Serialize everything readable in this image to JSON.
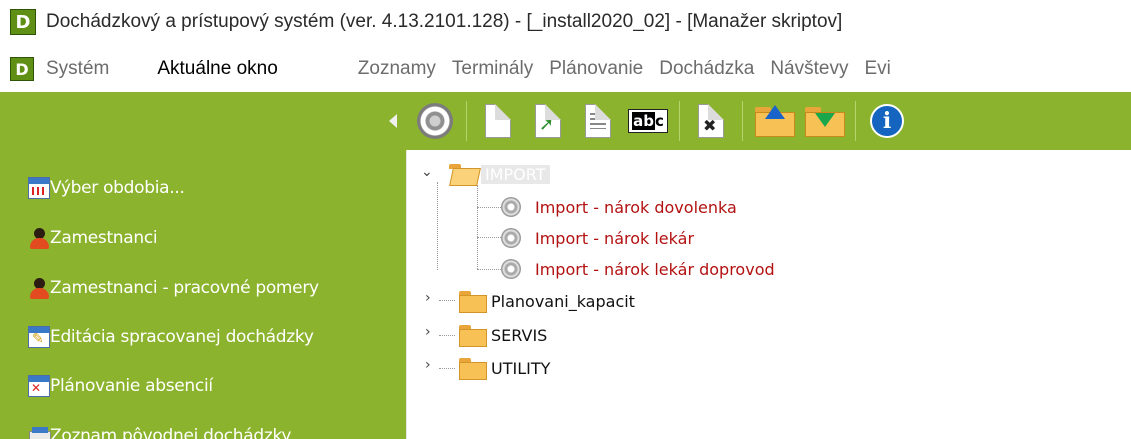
{
  "window": {
    "app_icon_letter": "D",
    "title": "Dochádzkový a prístupový systém (ver. 4.13.2101.128) - [_install2020_02] - [Manažer skriptov]"
  },
  "menubar": {
    "app_icon_letter": "D",
    "items": [
      "Systém",
      "Aktuálne okno",
      "Zoznamy",
      "Terminály",
      "Plánovanie",
      "Dochádzka",
      "Návštevy",
      "Evi"
    ]
  },
  "leftpanel": {
    "items": [
      {
        "label": "Výber obdobia...",
        "icon": "calendar-icon"
      },
      {
        "label": "Zamestnanci",
        "icon": "person-icon"
      },
      {
        "label": "Zamestnanci - pracovné pomery",
        "icon": "person-icon"
      },
      {
        "label": "Editácia spracovanej dochádzky",
        "icon": "edit-calendar-icon"
      },
      {
        "label": "Plánovanie absencií",
        "icon": "calendar-x-icon"
      },
      {
        "label": "Zoznam pôvodnej dochádzky",
        "icon": "list-icon"
      }
    ]
  },
  "toolbar": {
    "abc_label_1": "ab",
    "abc_label_2": "c",
    "info_label": "i"
  },
  "tree": {
    "root": {
      "label": "IMPORT",
      "expanded": true,
      "selected": true
    },
    "scripts": [
      "Import - nárok dovolenka",
      "Import - nárok lekár",
      "Import - nárok lekár doprovod"
    ],
    "folders": [
      "Planovani_kapacit",
      "SERVIS",
      "UTILITY"
    ],
    "colors": {
      "script_text": "#b31111",
      "panel": "#8cb32d"
    }
  }
}
